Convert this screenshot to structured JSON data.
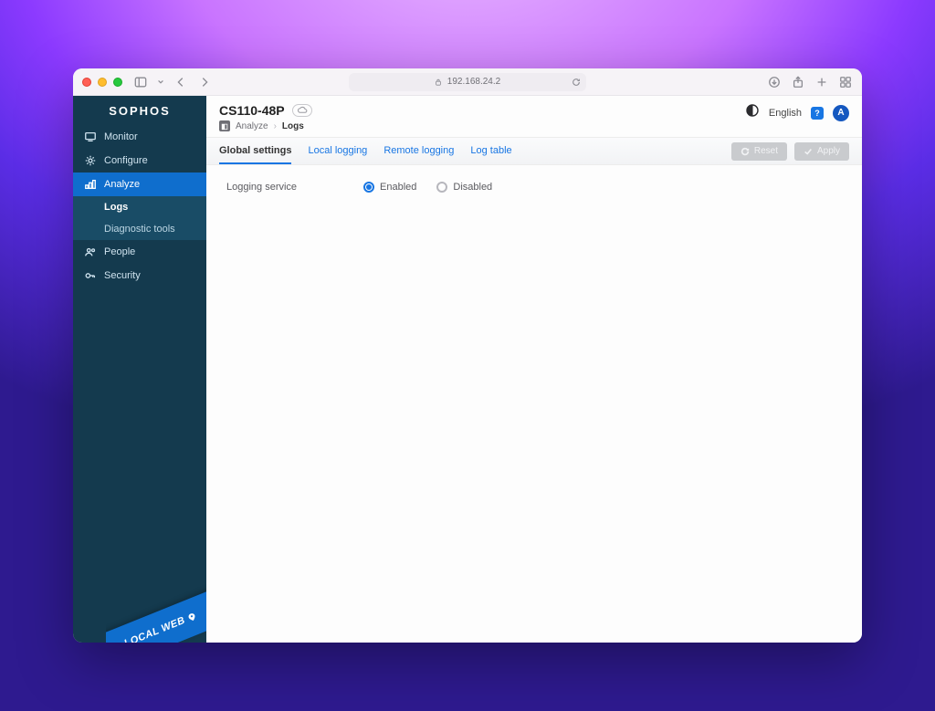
{
  "browser": {
    "address": "192.168.24.2"
  },
  "sidebar": {
    "brand": "SOPHOS",
    "items": [
      {
        "label": "Monitor"
      },
      {
        "label": "Configure"
      },
      {
        "label": "Analyze"
      },
      {
        "label": "People"
      },
      {
        "label": "Security"
      }
    ],
    "analyze_sub": [
      {
        "label": "Logs"
      },
      {
        "label": "Diagnostic tools"
      }
    ],
    "localweb": "LOCAL WEB"
  },
  "header": {
    "device": "CS110-48P",
    "breadcrumb_icon": "⎇",
    "breadcrumb1": "Analyze",
    "breadcrumb2": "Logs",
    "language": "English",
    "help_badge": "?",
    "avatar": "A"
  },
  "tabs": [
    {
      "label": "Global settings"
    },
    {
      "label": "Local logging"
    },
    {
      "label": "Remote logging"
    },
    {
      "label": "Log table"
    }
  ],
  "actions": {
    "reset": "Reset",
    "apply": "Apply"
  },
  "form": {
    "logging_label": "Logging service",
    "enabled": "Enabled",
    "disabled": "Disabled"
  }
}
